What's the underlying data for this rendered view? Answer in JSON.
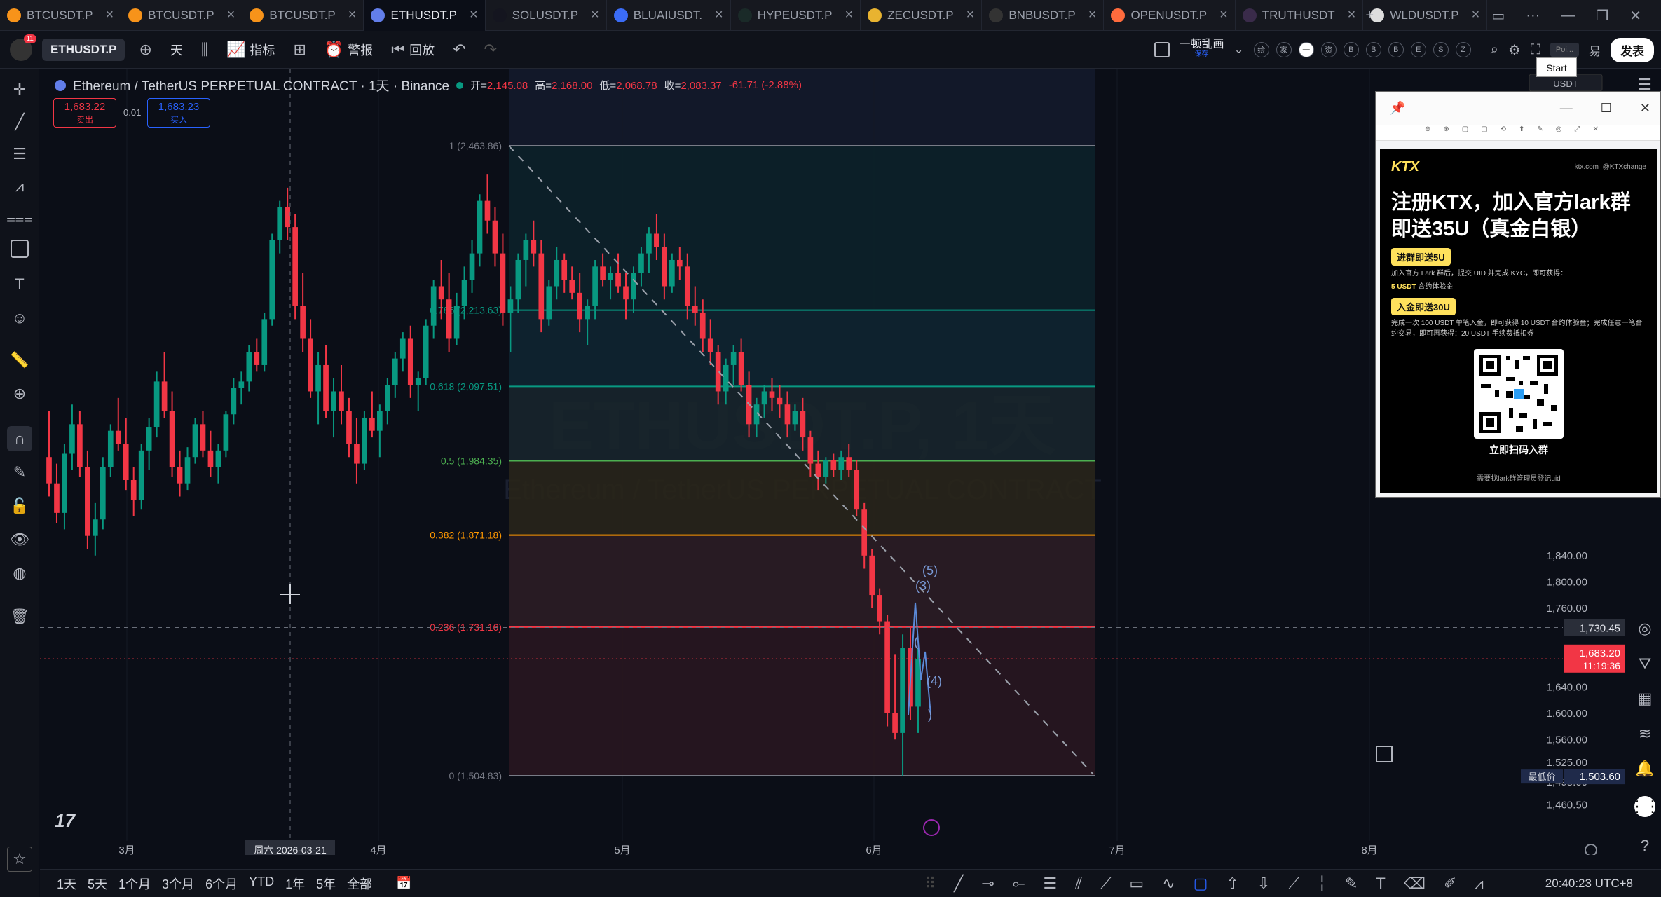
{
  "tabs": [
    {
      "label": "BTCUSDT.P",
      "icon": "bitcoin-icon",
      "color": "#f7931a",
      "active": false
    },
    {
      "label": "BTCUSDT.P",
      "icon": "bitcoin-icon",
      "color": "#f7931a",
      "active": false
    },
    {
      "label": "BTCUSDT.P",
      "icon": "bitcoin-icon",
      "color": "#f7931a",
      "active": false
    },
    {
      "label": "ETHUSDT.P",
      "icon": "ethereum-icon",
      "color": "#627eea",
      "active": true
    },
    {
      "label": "SOLUSDT.P",
      "icon": "solana-icon",
      "color": "#14151f",
      "active": false
    },
    {
      "label": "BLUAIUSDT.",
      "icon": "bluai-icon",
      "color": "#3b6cf6",
      "active": false
    },
    {
      "label": "HYPEUSDT.P",
      "icon": "hype-icon",
      "color": "#1a2a28",
      "active": false
    },
    {
      "label": "ZECUSDT.P",
      "icon": "zcash-icon",
      "color": "#e8b330",
      "active": false
    },
    {
      "label": "BNBUSDT.P",
      "icon": "bnb-icon",
      "color": "#333",
      "active": false
    },
    {
      "label": "OPENUSDT.P",
      "icon": "open-icon",
      "color": "#ff6b3d",
      "active": false
    },
    {
      "label": "TRUTHUSDT",
      "icon": "truth-icon",
      "color": "#3a2b4a",
      "active": false
    },
    {
      "label": "WLDUSDT.P",
      "icon": "worldcoin-icon",
      "color": "#ddd",
      "active": false
    }
  ],
  "toolbar": {
    "symbol": "ETHUSDT.P",
    "interval": "天",
    "indicators": "指标",
    "alert": "警报",
    "replay": "回放",
    "layout_name": "一顿乱画",
    "layout_sub": "保存",
    "publish": "发表",
    "search_hint": "Poi...",
    "trade_suffix": "易",
    "circles": [
      "绘",
      "家",
      "一",
      "资",
      "B",
      "B",
      "B",
      "E",
      "S",
      "Z"
    ]
  },
  "avatar_badge": "11",
  "legend": {
    "title": "Ethereum / TetherUS PERPETUAL CONTRACT · 1天 · Binance",
    "open_label": "开=",
    "open": "2,145.08",
    "high_label": "高=",
    "high": "2,168.00",
    "low_label": "低=",
    "low": "2,068.78",
    "close_label": "收=",
    "close": "2,083.37",
    "change": "-61.71 (-2.88%)"
  },
  "order": {
    "sell_price": "1,683.22",
    "sell_label": "卖出",
    "spread": "0.01",
    "buy_price": "1,683.23",
    "buy_label": "买入"
  },
  "watermark": {
    "symbol": "ETHUSDT.P, 1天",
    "subtitle": "Ethereum / TetherUS PERPETUAL CONTRACT"
  },
  "fib_levels": [
    {
      "ratio": "1",
      "price": "2,463.86",
      "color": "#787b86"
    },
    {
      "ratio": "0.786",
      "price": "2,213.63",
      "color": "#089981"
    },
    {
      "ratio": "0.618",
      "price": "2,097.51",
      "color": "#089981"
    },
    {
      "ratio": "0.5",
      "price": "1,984.35",
      "color": "#4caf50"
    },
    {
      "ratio": "0.382",
      "price": "1,871.18",
      "color": "#ff9800"
    },
    {
      "ratio": "0.236",
      "price": "1,731.16",
      "color": "#f23645"
    },
    {
      "ratio": "0",
      "price": "1,504.83",
      "color": "#787b86"
    }
  ],
  "fib_label_prefix": [
    "1 (2,463.86)",
    "0.786 (2,213.63)",
    "0.618 (2,097.51)",
    "0.5 (1,984.35)",
    "0.382 (1,871.18)",
    "0.236 (1,731.16)",
    "0 (1,504.83)"
  ],
  "elliott_labels": [
    "(5)",
    "(3)",
    "(",
    "(4)",
    ")"
  ],
  "price_axis": {
    "ticks": [
      "1,840.00",
      "1,800.00",
      "1,760.00",
      "1,640.00",
      "1,600.00",
      "1,560.00",
      "1,525.00",
      "1,495.00",
      "1,460.50"
    ],
    "crosshair_price": "1,730.45",
    "last_price": "1,683.20",
    "countdown": "11:19:36",
    "low_label": "最低价",
    "low_price": "1,503.60",
    "currency": "USDT"
  },
  "time_axis": {
    "ticks": [
      "3月",
      "4月",
      "5月",
      "6月",
      "7月",
      "8月"
    ],
    "crosshair_date": "周六 2026-03-21"
  },
  "bottom": {
    "ranges": [
      "1天",
      "5天",
      "1个月",
      "3个月",
      "6个月",
      "YTD",
      "1年",
      "5年",
      "全部"
    ],
    "clock": "20:40:23 UTC+8"
  },
  "ad": {
    "brand": "KTX",
    "site": "ktx.com",
    "handle": "@KTXchange",
    "headline": "注册KTX，加入官方lark群即送35U（真金白银）",
    "pill1": "进群即送5U",
    "text1": "加入官方 Lark 群后，提交 UID 并完成 KYC，即可获得：",
    "reward1": "5 USDT",
    "reward1_suffix": "合约体验金",
    "pill2": "入金即送30U",
    "text2": "完成一次 100 USDT 单笔入金，即可获得 10 USDT 合约体验金；完成任意一笔合约交易，即可再获得：20 USDT 手续费抵扣券",
    "scan": "立即扫码入群",
    "footer": "需要找lark群管理员登记uid"
  },
  "start_popup": "Start",
  "chart_data": {
    "type": "candlestick",
    "symbol": "ETHUSDT.P",
    "interval": "1D",
    "x_ticks": [
      "3月",
      "4月",
      "5月",
      "6月",
      "7月",
      "8月"
    ],
    "ylim": [
      1460,
      2500
    ],
    "last_price": 1683.2,
    "fibonacci": [
      2463.86,
      2213.63,
      2097.51,
      1984.35,
      1871.18,
      1731.16,
      1504.83
    ],
    "ohlc": [
      [
        1990,
        2060,
        1930,
        1950
      ],
      [
        1950,
        1980,
        1890,
        1905
      ],
      [
        1905,
        2010,
        1880,
        1995
      ],
      [
        1995,
        2070,
        1970,
        2040
      ],
      [
        2040,
        2060,
        1960,
        1975
      ],
      [
        1975,
        2000,
        1850,
        1870
      ],
      [
        1870,
        1920,
        1840,
        1895
      ],
      [
        1895,
        1990,
        1880,
        1975
      ],
      [
        1975,
        2040,
        1960,
        2030
      ],
      [
        2030,
        2080,
        2000,
        2010
      ],
      [
        2010,
        2050,
        1940,
        1955
      ],
      [
        1955,
        1975,
        1900,
        1925
      ],
      [
        1925,
        2010,
        1910,
        2000
      ],
      [
        2000,
        2050,
        1970,
        2035
      ],
      [
        2035,
        2120,
        2020,
        2105
      ],
      [
        2105,
        2150,
        2050,
        2060
      ],
      [
        2060,
        2090,
        1960,
        1975
      ],
      [
        1975,
        2000,
        1930,
        1950
      ],
      [
        1950,
        2005,
        1940,
        1990
      ],
      [
        1990,
        2050,
        1980,
        2040
      ],
      [
        2040,
        2060,
        1990,
        2000
      ],
      [
        2000,
        2030,
        1960,
        1975
      ],
      [
        1975,
        2010,
        1950,
        2000
      ],
      [
        2000,
        2060,
        1990,
        2055
      ],
      [
        2055,
        2110,
        2040,
        2095
      ],
      [
        2095,
        2120,
        2070,
        2105
      ],
      [
        2105,
        2160,
        2090,
        2150
      ],
      [
        2150,
        2170,
        2120,
        2130
      ],
      [
        2130,
        2210,
        2120,
        2200
      ],
      [
        2200,
        2330,
        2190,
        2320
      ],
      [
        2320,
        2380,
        2300,
        2370
      ],
      [
        2370,
        2400,
        2320,
        2340
      ],
      [
        2340,
        2360,
        2200,
        2220
      ],
      [
        2220,
        2270,
        2150,
        2170
      ],
      [
        2170,
        2200,
        2080,
        2090
      ],
      [
        2090,
        2150,
        2040,
        2130
      ],
      [
        2130,
        2160,
        2050,
        2060
      ],
      [
        2060,
        2110,
        2020,
        2090
      ],
      [
        2090,
        2130,
        2040,
        2060
      ],
      [
        2060,
        2080,
        1990,
        2010
      ],
      [
        2010,
        2050,
        1950,
        1980
      ],
      [
        1980,
        2060,
        1970,
        2050
      ],
      [
        2050,
        2090,
        2020,
        2030
      ],
      [
        2030,
        2070,
        1990,
        2060
      ],
      [
        2060,
        2110,
        2040,
        2100
      ],
      [
        2100,
        2150,
        2080,
        2140
      ],
      [
        2140,
        2180,
        2120,
        2170
      ],
      [
        2170,
        2190,
        2080,
        2100
      ],
      [
        2100,
        2120,
        2060,
        2110
      ],
      [
        2110,
        2200,
        2100,
        2190
      ],
      [
        2190,
        2260,
        2170,
        2250
      ],
      [
        2250,
        2290,
        2200,
        2230
      ],
      [
        2230,
        2270,
        2150,
        2170
      ],
      [
        2170,
        2240,
        2160,
        2220
      ],
      [
        2220,
        2280,
        2200,
        2260
      ],
      [
        2260,
        2320,
        2240,
        2300
      ],
      [
        2300,
        2390,
        2280,
        2380
      ],
      [
        2380,
        2420,
        2330,
        2350
      ],
      [
        2350,
        2370,
        2280,
        2300
      ],
      [
        2300,
        2330,
        2190,
        2210
      ],
      [
        2210,
        2250,
        2150,
        2230
      ],
      [
        2230,
        2300,
        2210,
        2290
      ],
      [
        2290,
        2330,
        2250,
        2320
      ],
      [
        2320,
        2350,
        2280,
        2300
      ],
      [
        2300,
        2320,
        2180,
        2200
      ],
      [
        2200,
        2260,
        2190,
        2250
      ],
      [
        2250,
        2310,
        2230,
        2290
      ],
      [
        2290,
        2300,
        2240,
        2260
      ],
      [
        2260,
        2280,
        2230,
        2240
      ],
      [
        2240,
        2270,
        2180,
        2200
      ],
      [
        2200,
        2230,
        2160,
        2220
      ],
      [
        2220,
        2290,
        2200,
        2280
      ],
      [
        2280,
        2300,
        2250,
        2260
      ],
      [
        2260,
        2280,
        2230,
        2270
      ],
      [
        2270,
        2300,
        2240,
        2250
      ],
      [
        2250,
        2270,
        2200,
        2230
      ],
      [
        2230,
        2280,
        2210,
        2270
      ],
      [
        2270,
        2310,
        2250,
        2300
      ],
      [
        2300,
        2340,
        2270,
        2330
      ],
      [
        2330,
        2360,
        2290,
        2310
      ],
      [
        2310,
        2330,
        2230,
        2250
      ],
      [
        2250,
        2300,
        2240,
        2290
      ],
      [
        2290,
        2310,
        2260,
        2280
      ],
      [
        2280,
        2300,
        2200,
        2220
      ],
      [
        2220,
        2250,
        2190,
        2210
      ],
      [
        2210,
        2230,
        2150,
        2170
      ],
      [
        2170,
        2200,
        2130,
        2150
      ],
      [
        2150,
        2160,
        2070,
        2090
      ],
      [
        2090,
        2140,
        2070,
        2130
      ],
      [
        2130,
        2160,
        2100,
        2150
      ],
      [
        2150,
        2170,
        2090,
        2100
      ],
      [
        2100,
        2120,
        2020,
        2040
      ],
      [
        2040,
        2080,
        2020,
        2070
      ],
      [
        2070,
        2100,
        2050,
        2090
      ],
      [
        2090,
        2110,
        2060,
        2080
      ],
      [
        2080,
        2100,
        2050,
        2070
      ],
      [
        2070,
        2090,
        2020,
        2040
      ],
      [
        2040,
        2070,
        2030,
        2060
      ],
      [
        2060,
        2080,
        2000,
        2020
      ],
      [
        2020,
        2030,
        1960,
        1980
      ],
      [
        1980,
        2000,
        1940,
        1960
      ],
      [
        1960,
        1990,
        1950,
        1985
      ],
      [
        1985,
        1995,
        1960,
        1970
      ],
      [
        1970,
        2000,
        1955,
        1990
      ],
      [
        1990,
        2010,
        1960,
        1970
      ],
      [
        1970,
        1985,
        1900,
        1910
      ],
      [
        1910,
        1920,
        1820,
        1840
      ],
      [
        1840,
        1850,
        1760,
        1780
      ],
      [
        1780,
        1790,
        1720,
        1740
      ],
      [
        1740,
        1750,
        1580,
        1600
      ],
      [
        1600,
        1690,
        1560,
        1570
      ],
      [
        1570,
        1720,
        1505,
        1700
      ],
      [
        1700,
        1730,
        1590,
        1610
      ],
      [
        1610,
        1700,
        1570,
        1683
      ]
    ]
  }
}
